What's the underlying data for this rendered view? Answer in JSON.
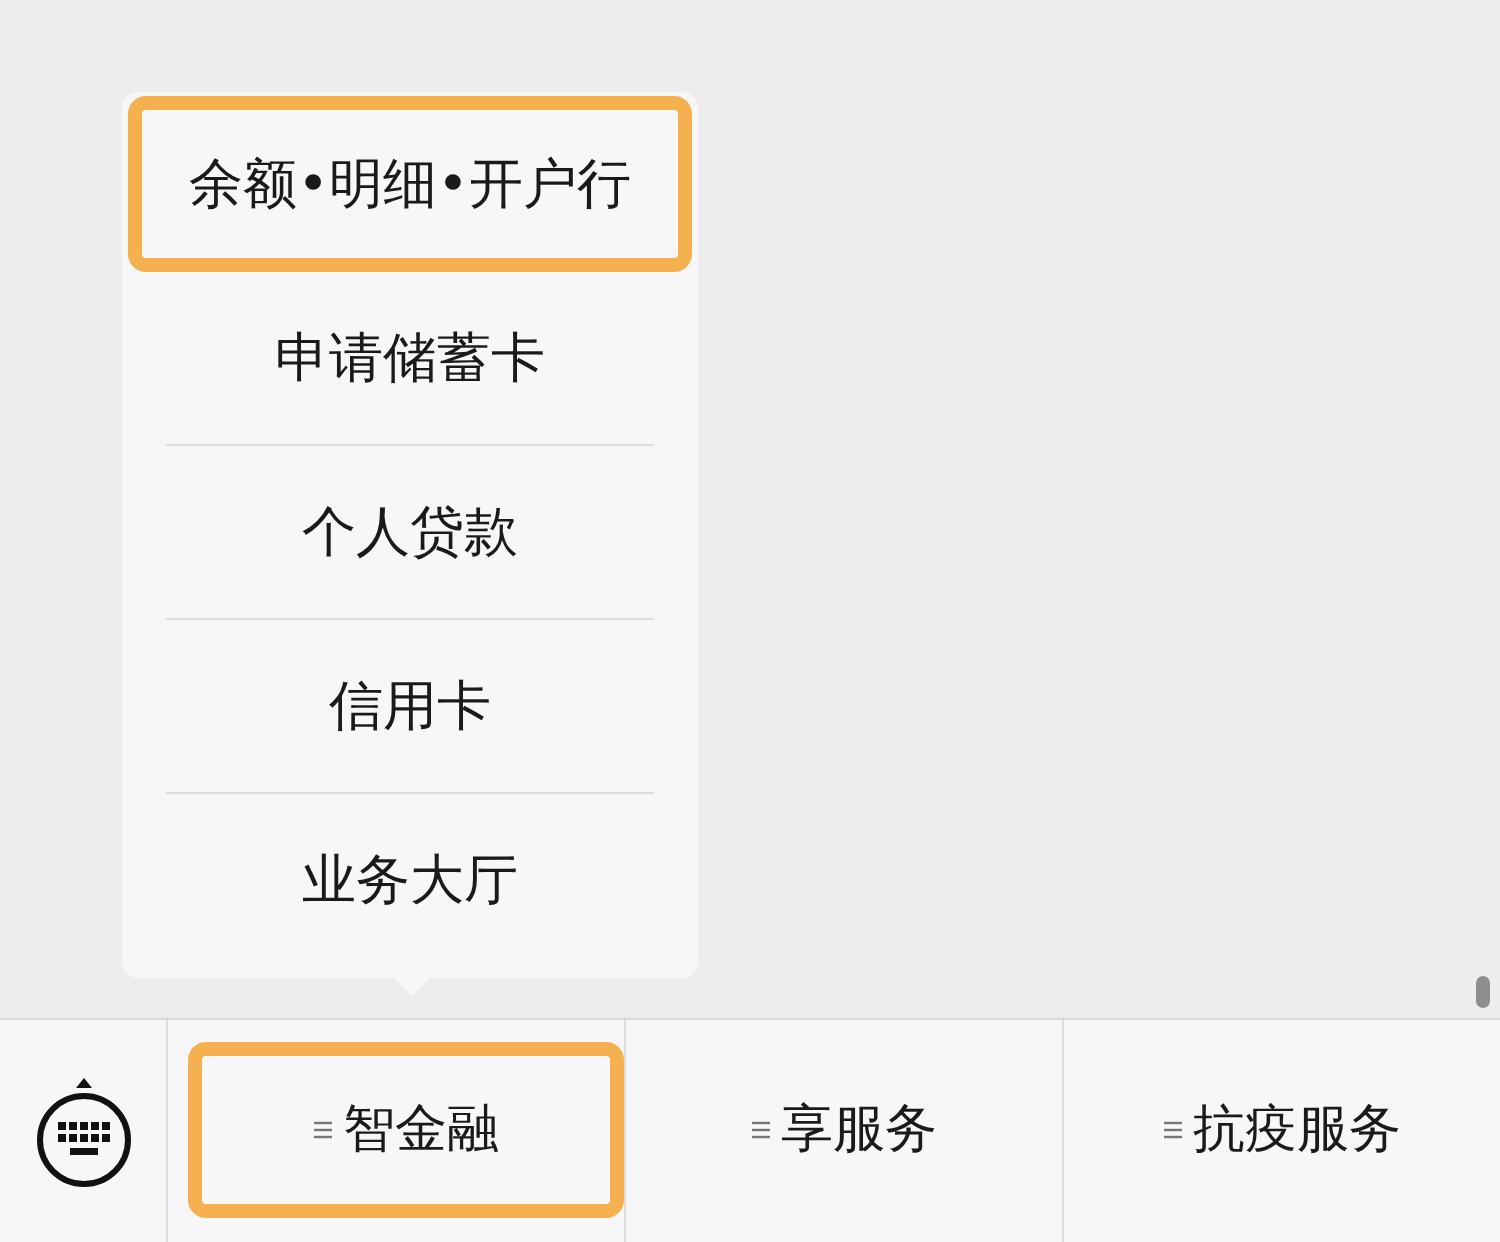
{
  "popup_menu": {
    "items": [
      {
        "label": "余额•明细•开户行",
        "highlighted": true
      },
      {
        "label": "申请储蓄卡",
        "highlighted": false
      },
      {
        "label": "个人贷款",
        "highlighted": false
      },
      {
        "label": "信用卡",
        "highlighted": false
      },
      {
        "label": "业务大厅",
        "highlighted": false
      }
    ]
  },
  "menu_bar": {
    "tabs": [
      {
        "label": "智金融",
        "highlighted": true
      },
      {
        "label": "享服务",
        "highlighted": false
      },
      {
        "label": "抗疫服务",
        "highlighted": false
      }
    ]
  }
}
